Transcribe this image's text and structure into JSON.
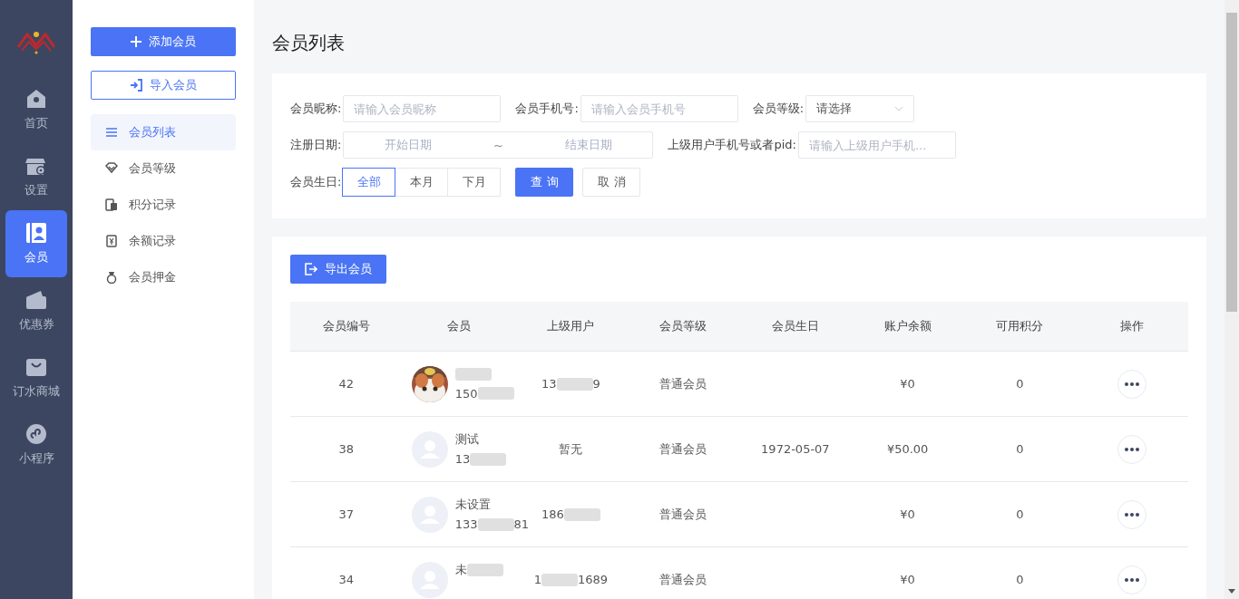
{
  "nav": [
    {
      "label": "首页",
      "selected": false
    },
    {
      "label": "设置",
      "selected": false
    },
    {
      "label": "会员",
      "selected": true
    },
    {
      "label": "优惠券",
      "selected": false
    },
    {
      "label": "订水商城",
      "selected": false
    },
    {
      "label": "小程序",
      "selected": false
    }
  ],
  "actions": {
    "add": "添加会员",
    "import": "导入会员"
  },
  "submenu": [
    {
      "label": "会员列表",
      "selected": true
    },
    {
      "label": "会员等级",
      "selected": false
    },
    {
      "label": "积分记录",
      "selected": false
    },
    {
      "label": "余额记录",
      "selected": false
    },
    {
      "label": "会员押金",
      "selected": false
    }
  ],
  "page_title": "会员列表",
  "filters": {
    "nickname": {
      "label": "会员昵称:",
      "placeholder": "请输入会员昵称"
    },
    "phone": {
      "label": "会员手机号:",
      "placeholder": "请输入会员手机号"
    },
    "level": {
      "label": "会员等级:",
      "value": "请选择"
    },
    "reg_date": {
      "label": "注册日期:",
      "start": "开始日期",
      "sep": "~",
      "end": "结束日期"
    },
    "parent": {
      "label": "上级用户手机号或者pid:",
      "placeholder": "请输入上级用户手机..."
    },
    "birthday": {
      "label": "会员生日:",
      "options": [
        {
          "label": "全部",
          "selected": true
        },
        {
          "label": "本月",
          "selected": false
        },
        {
          "label": "下月",
          "selected": false
        }
      ]
    },
    "query": "查 询",
    "cancel": "取 消"
  },
  "export": "导出会员",
  "table": {
    "columns": [
      "会员编号",
      "会员",
      "上级用户",
      "会员等级",
      "会员生日",
      "账户余额",
      "可用积分",
      "操作"
    ],
    "rows": [
      {
        "id": "42",
        "kind": "picture",
        "name": [
          {
            "kind": "blur"
          }
        ],
        "phone": [
          {
            "kind": "text",
            "text": "150"
          },
          {
            "kind": "blur"
          }
        ],
        "parent": [
          {
            "kind": "text",
            "text": "13"
          },
          {
            "kind": "blur"
          },
          {
            "kind": "text",
            "text": "9"
          }
        ],
        "level": "普通会员",
        "balance": "¥0",
        "points": "0"
      },
      {
        "id": "38",
        "kind": "default",
        "name": [
          {
            "kind": "text",
            "text": "测试"
          }
        ],
        "phone": [
          {
            "kind": "text",
            "text": "13"
          },
          {
            "kind": "blur"
          }
        ],
        "parent": [
          {
            "kind": "text",
            "text": "暂无"
          }
        ],
        "level": "普通会员",
        "birthday": "1972-05-07",
        "balance": "¥50.00",
        "points": "0"
      },
      {
        "id": "37",
        "kind": "default",
        "name": [
          {
            "kind": "text",
            "text": "未设置"
          }
        ],
        "phone": [
          {
            "kind": "text",
            "text": "133"
          },
          {
            "kind": "blur"
          },
          {
            "kind": "text",
            "text": "81"
          }
        ],
        "parent": [
          {
            "kind": "text",
            "text": "186"
          },
          {
            "kind": "blur"
          }
        ],
        "level": "普通会员",
        "balance": "¥0",
        "points": "0"
      },
      {
        "id": "34",
        "kind": "default",
        "name": [
          {
            "kind": "text",
            "text": "未"
          },
          {
            "kind": "blur"
          }
        ],
        "parent": [
          {
            "kind": "text",
            "text": "1"
          },
          {
            "kind": "blur"
          },
          {
            "kind": "text",
            "text": "1689"
          }
        ],
        "level": "普通会员",
        "balance": "¥0",
        "points": "0"
      }
    ]
  }
}
